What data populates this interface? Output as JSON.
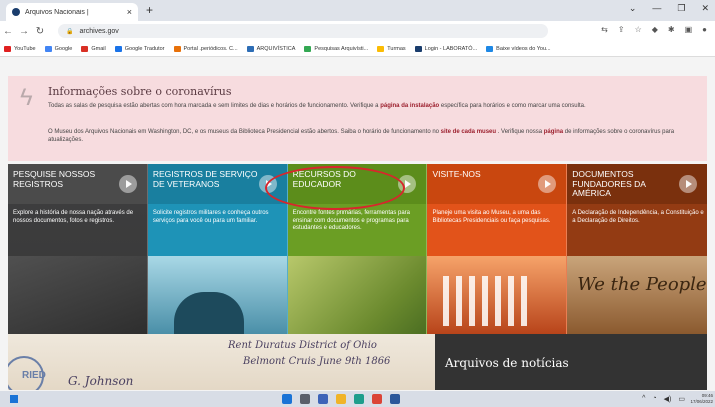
{
  "browser": {
    "tab_title": "Arquivos Nacionais |",
    "tab_close": "×",
    "new_tab": "+",
    "url": "archives.gov",
    "bookmarks": [
      {
        "label": "YouTube",
        "color": "#e02020"
      },
      {
        "label": "Google",
        "color": "#4285f4"
      },
      {
        "label": "Gmail",
        "color": "#d93025"
      },
      {
        "label": "Google Tradutor",
        "color": "#1a73e8"
      },
      {
        "label": "Portal .periódicos. C...",
        "color": "#e8710a"
      },
      {
        "label": "ARQUIVÍSTICA",
        "color": "#2d6db5"
      },
      {
        "label": "Pesquisas Arquivísti...",
        "color": "#34a853"
      },
      {
        "label": "Turmas",
        "color": "#fbbc04"
      },
      {
        "label": "Login - LABORATÓ...",
        "color": "#1a3d6d"
      },
      {
        "label": "Baixe vídeos do You...",
        "color": "#1e88e5"
      }
    ]
  },
  "alert": {
    "title": "Informações sobre o coronavírus",
    "p1_before": "Todas as salas de pesquisa estão abertas com hora marcada e sem limites de dias e horários de funcionamento. Verifique a ",
    "p1_link": "página da instalação",
    "p1_after": " específica  para horários e como marcar uma consulta.",
    "p2_before": "O Museu dos Arquivos Nacionais em Washington, DC, e os museus da Biblioteca Presidencial estão abertos. Saiba o horário de funcionamento no ",
    "p2_link1": "site de cada museu",
    "p2_mid": " . Verifique nossa ",
    "p2_link2": "página",
    "p2_after": " de informações sobre o coronavírus para atualizações."
  },
  "cards": [
    {
      "title": "PESQUISE NOSSOS REGISTROS",
      "description": "Explore a história de nossa nação através de nossos documentos, fotos e registros."
    },
    {
      "title": "REGISTROS DE SERVIÇO DE VETERANOS",
      "description": "Solicite registros militares e conheça outros serviços para você ou para um familiar."
    },
    {
      "title": "RECURSOS DO EDUCADOR",
      "description": "Encontre fontes primárias, ferramentas para ensinar com documentos e programas para estudantes e educadores."
    },
    {
      "title": "VISITE-NOS",
      "description": "Planeje uma visita ao Museu, a uma das Bibliotecas Presidenciais ou faça pesquisas."
    },
    {
      "title": "DOCUMENTOS FUNDADORES DA AMÉRICA",
      "description": "A Declaração de Independência, a Constituição e a Declaração de Direitos."
    }
  ],
  "card_image_text": {
    "card5": "We the People"
  },
  "bottom": {
    "handwriting_1": "Rent Duratus District of Ohio",
    "handwriting_2": "Belmont Cruis June 9th 1866",
    "handwriting_3": "G. Johnson",
    "stamp": "RIED",
    "news_title": "Arquivos de notícias"
  },
  "taskbar": {
    "clock_time": "09:46",
    "clock_date": "17/06/2022"
  }
}
